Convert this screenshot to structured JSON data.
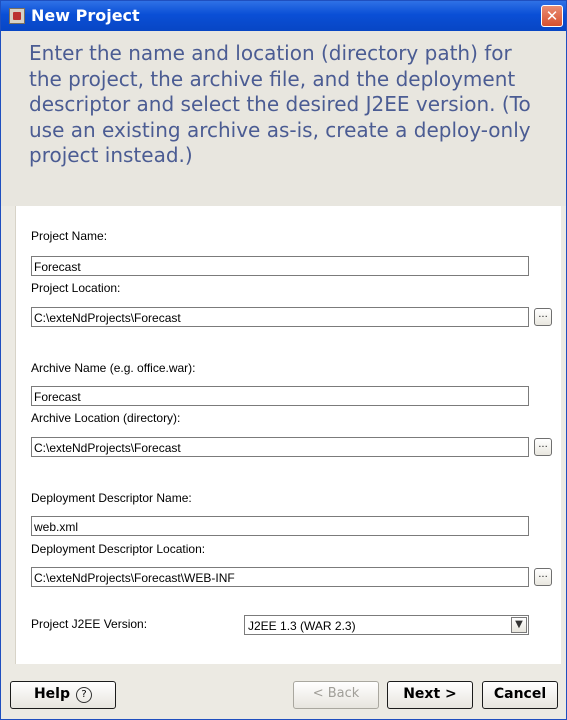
{
  "window": {
    "title": "New Project",
    "close_symbol": "✕"
  },
  "header": {
    "instructions": "Enter the name and location (directory path) for the project, the archive file, and the deployment descriptor and select the desired J2EE version. (To use an existing archive as-is, create a deploy-only project instead.)"
  },
  "form": {
    "project_name_label": "Project Name:",
    "project_name_value": "Forecast",
    "project_location_label": "Project Location:",
    "project_location_value": "C:\\exteNdProjects\\Forecast",
    "archive_name_label": "Archive Name (e.g. office.war):",
    "archive_name_value": "Forecast",
    "archive_location_label": "Archive Location (directory):",
    "archive_location_value": "C:\\exteNdProjects\\Forecast",
    "dd_name_label": "Deployment Descriptor Name:",
    "dd_name_value": "web.xml",
    "dd_location_label": "Deployment Descriptor Location:",
    "dd_location_value": "C:\\exteNdProjects\\Forecast\\WEB-INF",
    "j2ee_version_label": "Project J2EE Version:",
    "j2ee_version_selected": "J2EE 1.3 (WAR 2.3)",
    "browse_label": "..."
  },
  "buttons": {
    "help": "Help",
    "help_icon": "?",
    "back": "< Back",
    "next": "Next >",
    "cancel": "Cancel"
  },
  "icons": {
    "app": "project-icon",
    "close": "close-icon",
    "dropdown": "chevron-down-icon",
    "help": "question-circle-icon"
  },
  "colors": {
    "titlebar": "#0a4fd6",
    "header_text": "#4b5c93",
    "close_button": "#d7502e"
  }
}
